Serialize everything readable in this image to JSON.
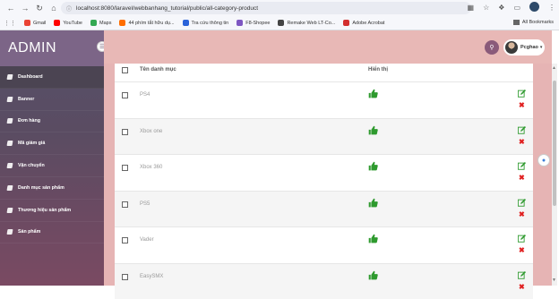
{
  "browser": {
    "url": "localhost:8080/laravel/webbanhang_tutorial/public/all-category-product",
    "bookmarks": [
      {
        "label": "Gmail",
        "color": "#ea4335"
      },
      {
        "label": "YouTube",
        "color": "#ff0000"
      },
      {
        "label": "Maps",
        "color": "#34a853"
      },
      {
        "label": "44 phím tắt hữu dụ...",
        "color": "#ff6d00"
      },
      {
        "label": "Tra cứu thông tin",
        "color": "#2b63d9"
      },
      {
        "label": "F8-Shopee",
        "color": "#7e57c2"
      },
      {
        "label": "Remake Web LT-Co...",
        "color": "#444444"
      },
      {
        "label": "Adobe Acrobat",
        "color": "#d32f2f"
      }
    ],
    "all_bookmarks": "All Bookmarks"
  },
  "sidebar": {
    "logo": "ADMIN",
    "items": [
      {
        "label": "Dashboard"
      },
      {
        "label": "Banner"
      },
      {
        "label": "Đơn hàng"
      },
      {
        "label": "Mã giảm giá"
      },
      {
        "label": "Vận chuyển"
      },
      {
        "label": "Danh mục sản phẩm"
      },
      {
        "label": "Thương hiệu sản phẩm"
      },
      {
        "label": "Sản phẩm"
      }
    ]
  },
  "header": {
    "username": "Pcghao"
  },
  "table": {
    "col_name": "Tên danh mục",
    "col_show": "Hiển thị",
    "rows": [
      {
        "name": "PS4"
      },
      {
        "name": "Xbox one"
      },
      {
        "name": "Xbox 360"
      },
      {
        "name": "PS5"
      },
      {
        "name": "Vader"
      },
      {
        "name": "EasySMX"
      }
    ]
  },
  "colors": {
    "sidebar": "#5a4c62",
    "header": "#e8b8b6",
    "accent": "#8a5a7a",
    "thumb": "#2e9a2e",
    "edit": "#2e9a2e",
    "delete": "#e02020"
  },
  "icons": [
    "back-icon",
    "forward-icon",
    "reload-icon",
    "home-icon",
    "translate-icon",
    "star-icon",
    "extensions-icon",
    "thumbs-up-icon",
    "edit-icon",
    "delete-icon",
    "search-icon",
    "menu-icon"
  ]
}
